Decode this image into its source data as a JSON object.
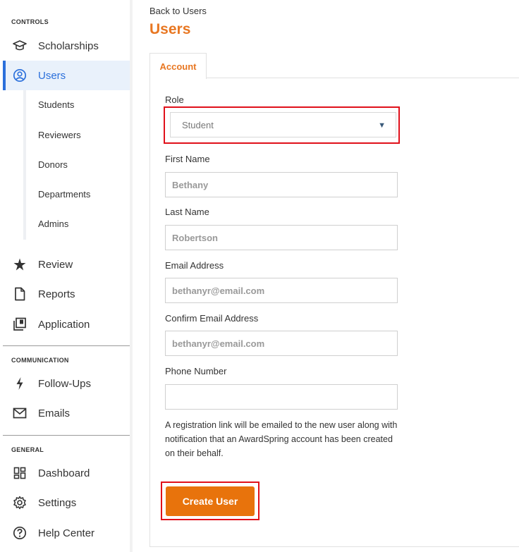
{
  "sidebar": {
    "controls_label": "CONTROLS",
    "communication_label": "COMMUNICATION",
    "general_label": "GENERAL",
    "items": {
      "scholarships": {
        "label": "Scholarships",
        "icon": "graduation-cap-icon"
      },
      "users": {
        "label": "Users",
        "icon": "user-circle-icon"
      },
      "review": {
        "label": "Review",
        "icon": "star-icon"
      },
      "reports": {
        "label": "Reports",
        "icon": "document-icon"
      },
      "application": {
        "label": "Application",
        "icon": "stacked-pages-icon"
      },
      "follow_ups": {
        "label": "Follow-Ups",
        "icon": "lightning-icon"
      },
      "emails": {
        "label": "Emails",
        "icon": "envelope-icon"
      },
      "dashboard": {
        "label": "Dashboard",
        "icon": "dashboard-grid-icon"
      },
      "settings": {
        "label": "Settings",
        "icon": "gear-icon"
      },
      "help_center": {
        "label": "Help Center",
        "icon": "question-circle-icon"
      }
    },
    "users_subitems": [
      "Students",
      "Reviewers",
      "Donors",
      "Departments",
      "Admins"
    ]
  },
  "main": {
    "back_link": "Back to Users",
    "title": "Users",
    "tab": "Account",
    "form": {
      "role_label": "Role",
      "role_value": "Student",
      "first_name_label": "First Name",
      "first_name_value": "Bethany",
      "last_name_label": "Last Name",
      "last_name_value": "Robertson",
      "email_label": "Email Address",
      "email_value": "bethanyr@email.com",
      "confirm_email_label": "Confirm Email Address",
      "confirm_email_value": "bethanyr@email.com",
      "phone_label": "Phone Number",
      "phone_value": "",
      "help_text": "A registration link will be emailed to the new user along with notification that an AwardSpring account has been created on their behalf.",
      "submit_label": "Create User"
    }
  },
  "colors": {
    "accent": "#e87722",
    "button": "#e8730c",
    "active_nav": "#2a6fdb",
    "highlight": "#e0101a"
  }
}
